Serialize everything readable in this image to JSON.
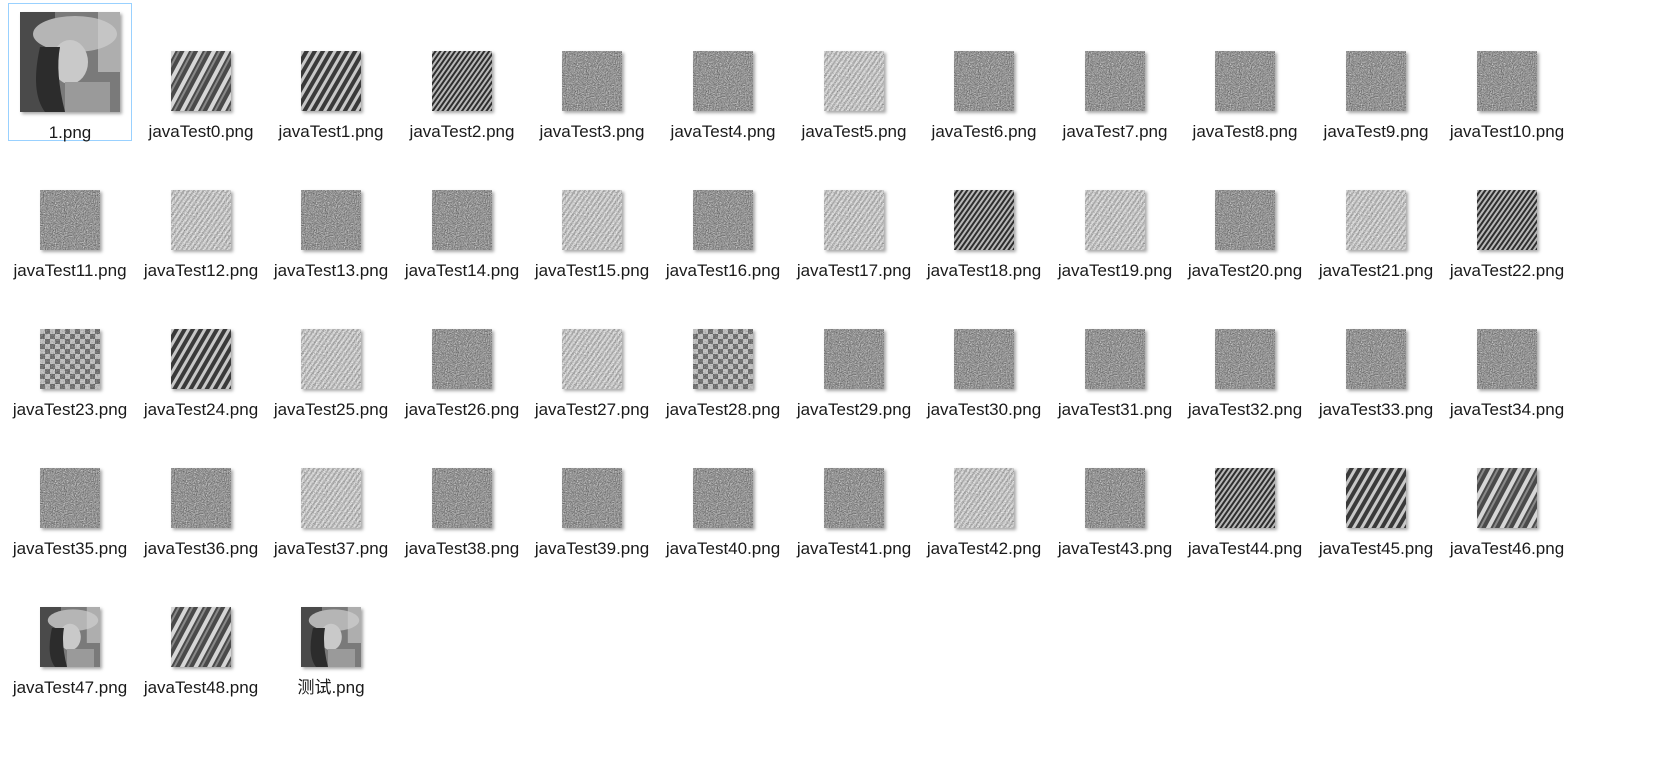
{
  "window": {
    "view": "Large icons"
  },
  "files": [
    {
      "name": "1.png",
      "thumb": "lena",
      "selected": true
    },
    {
      "name": "javaTest0.png",
      "thumb": "stripes-coarse"
    },
    {
      "name": "javaTest1.png",
      "thumb": "stripes-medium"
    },
    {
      "name": "javaTest2.png",
      "thumb": "stripes-fine"
    },
    {
      "name": "javaTest3.png",
      "thumb": "noise"
    },
    {
      "name": "javaTest4.png",
      "thumb": "noise"
    },
    {
      "name": "javaTest5.png",
      "thumb": "noise-diagonal"
    },
    {
      "name": "javaTest6.png",
      "thumb": "noise"
    },
    {
      "name": "javaTest7.png",
      "thumb": "noise"
    },
    {
      "name": "javaTest8.png",
      "thumb": "noise"
    },
    {
      "name": "javaTest9.png",
      "thumb": "noise"
    },
    {
      "name": "javaTest10.png",
      "thumb": "noise"
    },
    {
      "name": "javaTest11.png",
      "thumb": "noise"
    },
    {
      "name": "javaTest12.png",
      "thumb": "noise-diagonal"
    },
    {
      "name": "javaTest13.png",
      "thumb": "noise"
    },
    {
      "name": "javaTest14.png",
      "thumb": "noise"
    },
    {
      "name": "javaTest15.png",
      "thumb": "noise-diagonal"
    },
    {
      "name": "javaTest16.png",
      "thumb": "noise"
    },
    {
      "name": "javaTest17.png",
      "thumb": "noise-diagonal"
    },
    {
      "name": "javaTest18.png",
      "thumb": "stripes-fine"
    },
    {
      "name": "javaTest19.png",
      "thumb": "noise-diagonal"
    },
    {
      "name": "javaTest20.png",
      "thumb": "noise"
    },
    {
      "name": "javaTest21.png",
      "thumb": "noise-diagonal"
    },
    {
      "name": "javaTest22.png",
      "thumb": "stripes-fine"
    },
    {
      "name": "javaTest23.png",
      "thumb": "checker"
    },
    {
      "name": "javaTest24.png",
      "thumb": "stripes-medium"
    },
    {
      "name": "javaTest25.png",
      "thumb": "noise-diagonal"
    },
    {
      "name": "javaTest26.png",
      "thumb": "noise"
    },
    {
      "name": "javaTest27.png",
      "thumb": "noise-diagonal"
    },
    {
      "name": "javaTest28.png",
      "thumb": "checker"
    },
    {
      "name": "javaTest29.png",
      "thumb": "noise"
    },
    {
      "name": "javaTest30.png",
      "thumb": "noise"
    },
    {
      "name": "javaTest31.png",
      "thumb": "noise"
    },
    {
      "name": "javaTest32.png",
      "thumb": "noise"
    },
    {
      "name": "javaTest33.png",
      "thumb": "noise"
    },
    {
      "name": "javaTest34.png",
      "thumb": "noise"
    },
    {
      "name": "javaTest35.png",
      "thumb": "noise"
    },
    {
      "name": "javaTest36.png",
      "thumb": "noise"
    },
    {
      "name": "javaTest37.png",
      "thumb": "noise-diagonal"
    },
    {
      "name": "javaTest38.png",
      "thumb": "noise"
    },
    {
      "name": "javaTest39.png",
      "thumb": "noise"
    },
    {
      "name": "javaTest40.png",
      "thumb": "noise"
    },
    {
      "name": "javaTest41.png",
      "thumb": "noise"
    },
    {
      "name": "javaTest42.png",
      "thumb": "noise-diagonal"
    },
    {
      "name": "javaTest43.png",
      "thumb": "noise"
    },
    {
      "name": "javaTest44.png",
      "thumb": "stripes-fine"
    },
    {
      "name": "javaTest45.png",
      "thumb": "stripes-medium"
    },
    {
      "name": "javaTest46.png",
      "thumb": "stripes-coarse"
    },
    {
      "name": "javaTest47.png",
      "thumb": "lena"
    },
    {
      "name": "javaTest48.png",
      "thumb": "stripes-coarse"
    },
    {
      "name": "测试.png",
      "thumb": "lena"
    }
  ],
  "colors": {
    "selection_border": "#99d1ff",
    "text": "#1a1a1a",
    "background": "#ffffff"
  }
}
